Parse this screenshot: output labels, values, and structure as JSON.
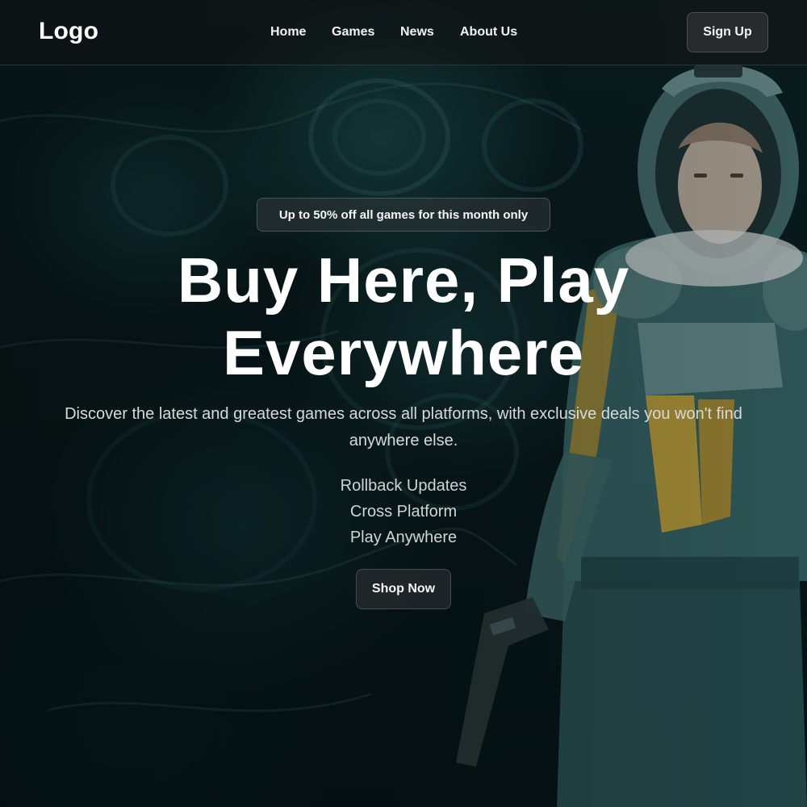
{
  "nav": {
    "logo": "Logo",
    "links": [
      "Home",
      "Games",
      "News",
      "About Us"
    ],
    "signup_label": "Sign Up"
  },
  "hero": {
    "promo_badge": "Up to 50% off all games for this month only",
    "headline_line1": "Buy Here, Play",
    "headline_line2": "Everywhere",
    "description": "Discover the latest and greatest games across all platforms, with exclusive deals you won't find anywhere else.",
    "features": [
      "Rollback Updates",
      "Cross Platform",
      "Play Anywhere"
    ],
    "cta_label": "Shop Now",
    "background_image": "astronaut-in-teal-spacesuit"
  },
  "colors": {
    "background": "#0a1d20",
    "teal_accent": "#3e8a86",
    "suit_yellow": "#c9a53a",
    "text_primary": "#ffffff",
    "text_secondary": "#d6dada"
  }
}
